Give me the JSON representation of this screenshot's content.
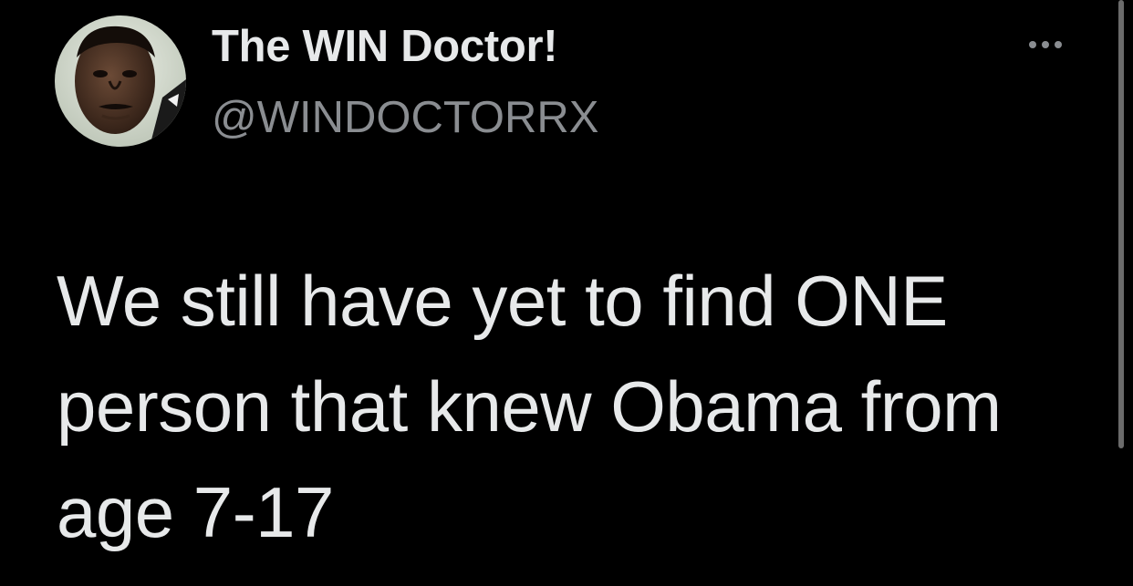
{
  "tweet": {
    "author": {
      "display_name": "The WIN Doctor!",
      "handle": "@WINDOCTORRX",
      "avatar_icon": "profile-photo"
    },
    "more_icon": "more-options-icon",
    "text": "We still have yet to find ONE person that knew Obama from age 7-17"
  },
  "colors": {
    "background": "#000000",
    "primary_text": "#e7e9ea",
    "secondary_text": "#8a8d91"
  }
}
